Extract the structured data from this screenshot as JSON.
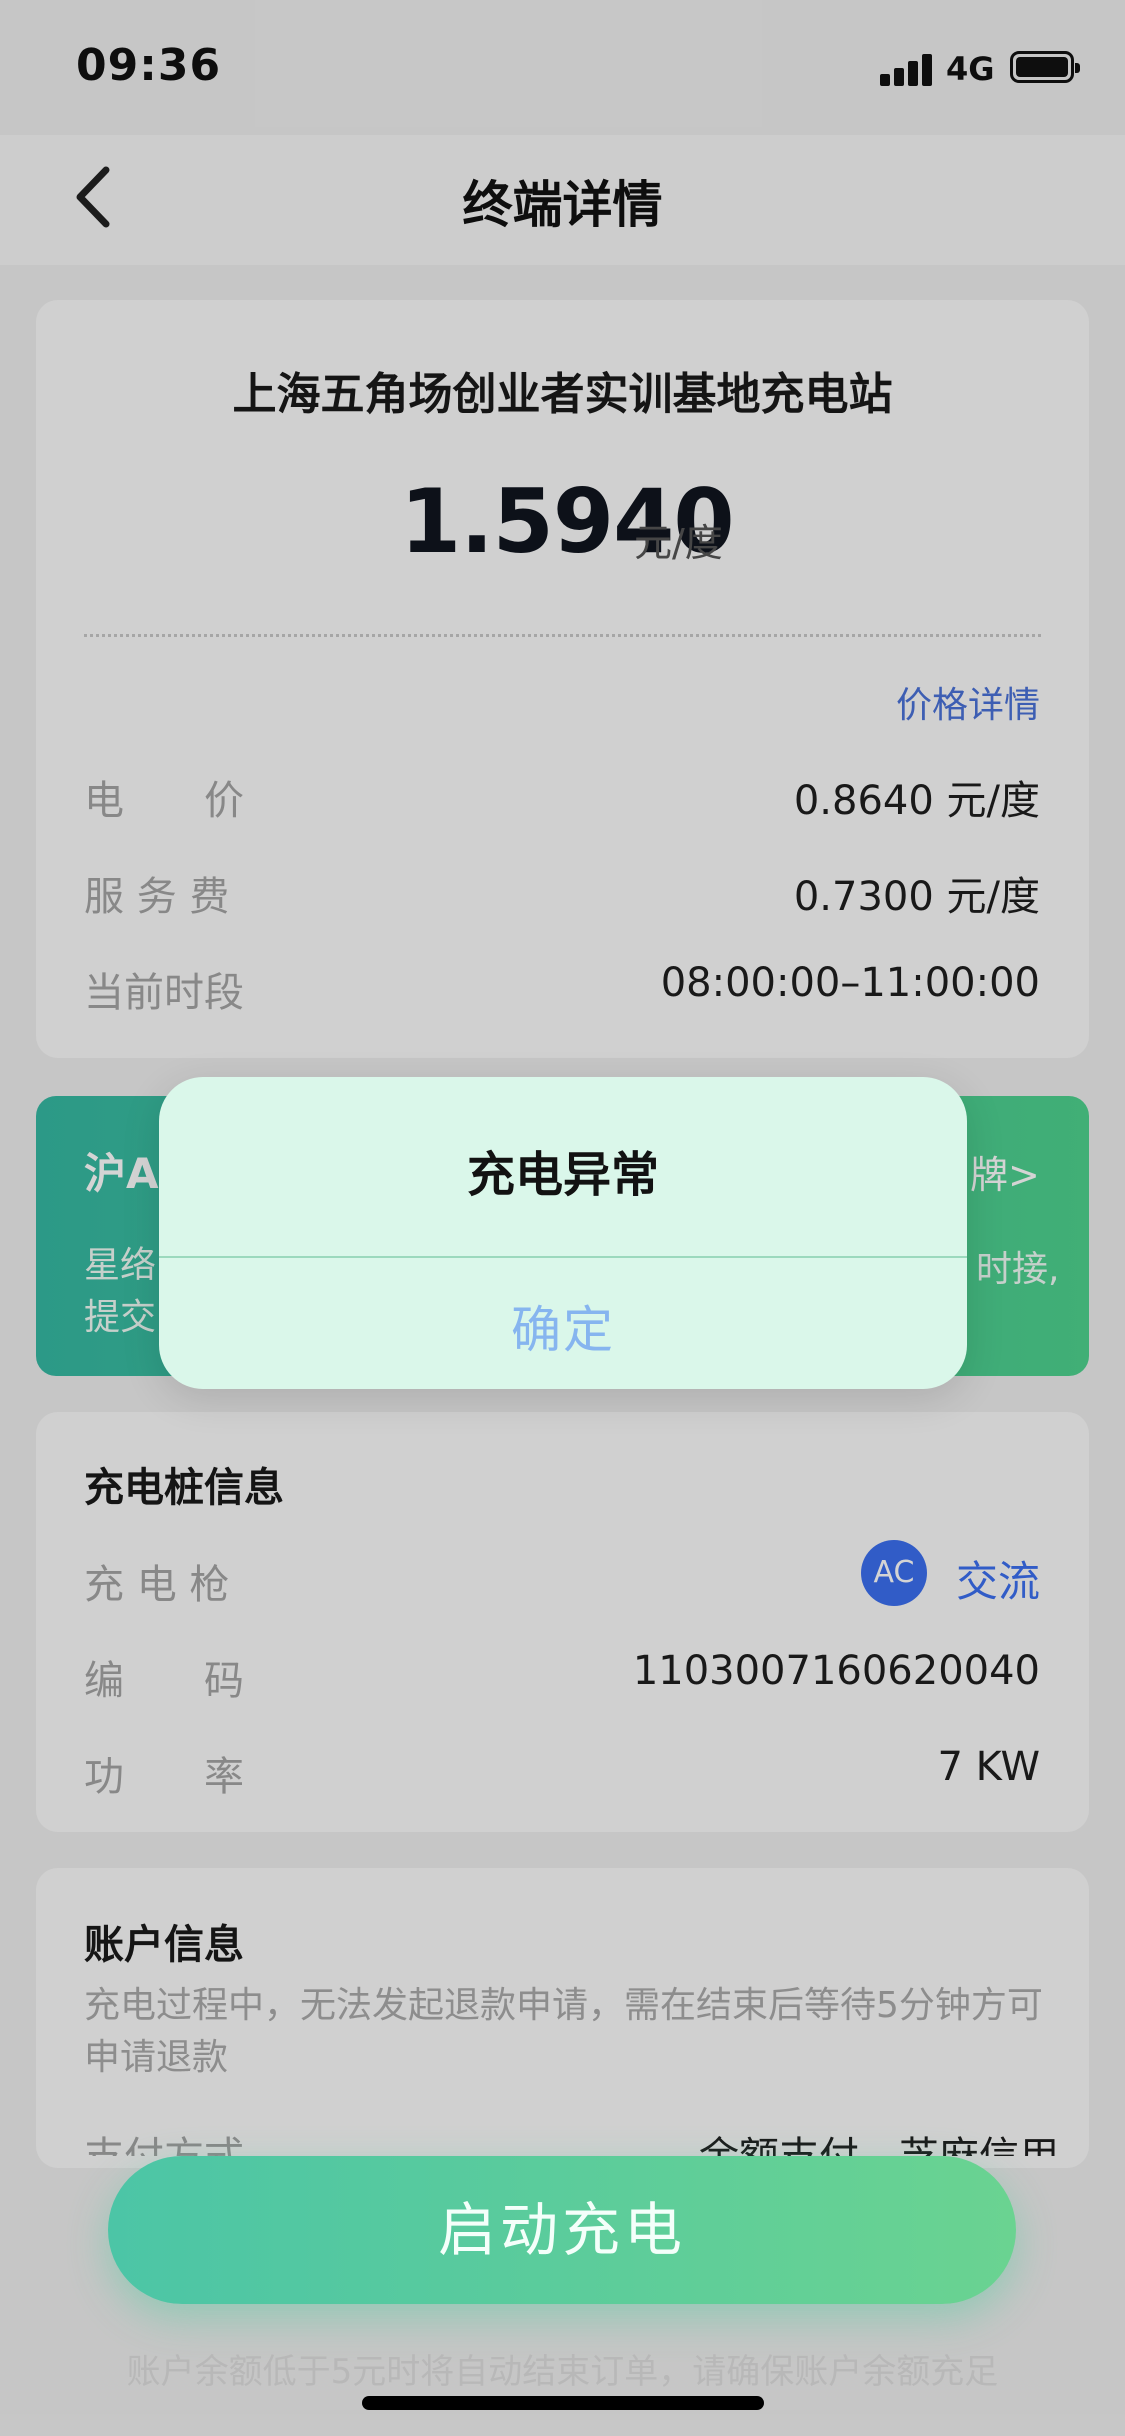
{
  "status_bar": {
    "time": "09:36",
    "network": "4G"
  },
  "nav": {
    "title": "终端详情"
  },
  "station": {
    "name": "上海五角场创业者实训基地充电站",
    "total_price": "1.5940",
    "unit": "元/度",
    "price_detail_link": "价格详情",
    "rows": [
      {
        "label": "电　　价",
        "value": "0.8640 元/度"
      },
      {
        "label": "服 务 费",
        "value": "0.7300 元/度"
      },
      {
        "label": "当前时段",
        "value": "08:00:00–11:00:00"
      }
    ]
  },
  "plate_banner": {
    "title_left": "沪A",
    "title_right": "牌>",
    "line1_left": "星络",
    "line1_right": "时接,",
    "line2_left": "提交"
  },
  "pile_info": {
    "title": "充电桩信息",
    "gun_label": "充 电 枪",
    "gun_badge": "AC",
    "gun_type": "交流",
    "code_label": "编　　码",
    "code_value": "1103007160620040",
    "power_label": "功　　率",
    "power_value": "7 KW"
  },
  "account": {
    "title": "账户信息",
    "note": "充电过程中，无法发起退款申请，需在结束后等待5分钟方可申请退款",
    "pay_label": "支付方式",
    "pay_value": "余额支付　芝麻信用"
  },
  "start_button": {
    "label": "启动充电"
  },
  "footer_note": "账户余额低于5元时将自动结束订单，请确保账户余额充足",
  "dialog": {
    "title": "充电异常",
    "confirm": "确定"
  },
  "colors": {
    "accent_blue": "#3c6ff0",
    "brand_green": "#4fd38f",
    "dialog_bg": "#daf7ea"
  }
}
